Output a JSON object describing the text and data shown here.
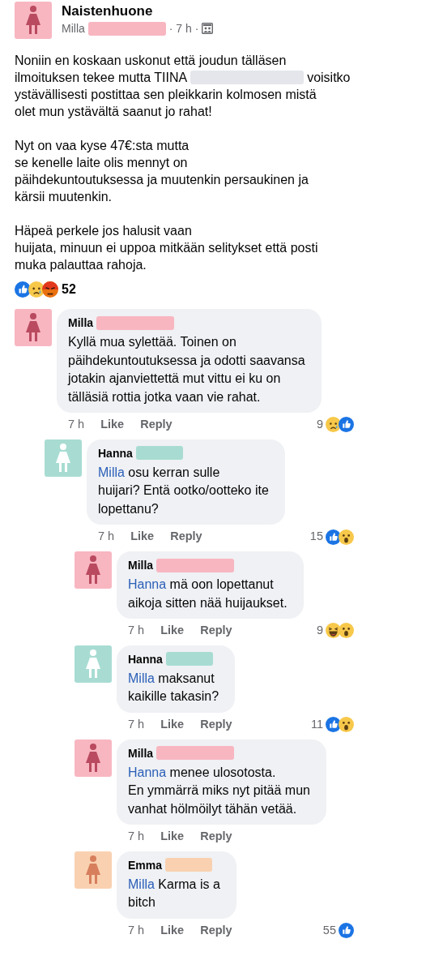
{
  "post": {
    "group": "Naistenhuone",
    "author": "Milla",
    "redaction": {
      "kind": "long"
    },
    "time": "· 7 h ·",
    "avatar": {
      "color": "#f8b6c1",
      "figure": {
        "color": "#b94a5f"
      }
    },
    "paragraphs": [
      [
        {
          "kind": "text",
          "text": "Noniin en koskaan uskonut että joudun tälläsen\nilmoituksen tekee mutta TIINA "
        },
        {
          "kind": "redaction",
          "color": "#e4e6eb"
        },
        {
          "kind": "text",
          "text": " voisitko\nystävällisesti postittaa sen pleikkarin kolmosen mistä\nolet mun ystävältä saanut jo rahat!"
        }
      ],
      [
        {
          "kind": "text",
          "text": "Nyt on vaa kyse 47€:sta mutta\nse kenelle laite olis mennyt on\npäihdekuntoutuksessa ja muutenkin persaukinen ja\nkärsii muutenkin."
        }
      ],
      [
        {
          "kind": "text",
          "text": "Häpeä perkele jos halusit vaan\nhuijata, minuun ei uppoa mitkään selitykset että posti\nmuka palauttaa rahoja."
        }
      ]
    ],
    "reactions": [
      {
        "kind": "like"
      },
      {
        "kind": "sad"
      },
      {
        "kind": "angry"
      }
    ],
    "reaction_count": "52"
  },
  "comments": [
    {
      "author": "Milla",
      "redaction": {
        "kind": "long"
      },
      "avatar": {
        "color": "#f8b6c1",
        "figure": {
          "color": "#b94a5f"
        }
      },
      "text": "Kyllä mua sylettää. Toinen on\npäihdekuntoutuksessa ja odotti saavansa\njotakin ajanviettettä mut vittu ei ku on\ntälläsiä rottia jotka vaan vie rahat.",
      "time": "7 h",
      "actions": [
        "Like",
        "Reply"
      ],
      "reaction_count": "9",
      "reactions": [
        {
          "kind": "sad"
        },
        {
          "kind": "like"
        }
      ],
      "children": [
        {
          "author": "Hanna",
          "redaction": {
            "kind": "short"
          },
          "avatar": {
            "color": "#a8dcd3",
            "figure": {
              "color": "#ffffff"
            }
          },
          "mention": "Milla",
          "text": " osu kerran sulle\nhuijari? Entä ootko/ootteko ite\nlopettanu?",
          "time": "7 h",
          "actions": [
            "Like",
            "Reply"
          ],
          "reaction_count": "15",
          "reactions": [
            {
              "kind": "like"
            },
            {
              "kind": "wow"
            }
          ],
          "children": [
            {
              "author": "Milla",
              "redaction": {
                "kind": "long"
              },
              "avatar": {
                "color": "#f8b6c1",
                "figure": {
                  "color": "#b94a5f"
                }
              },
              "mention": "Hanna",
              "text": " mä oon lopettanut\naikoja sitten nää huijaukset.",
              "time": "7 h",
              "actions": [
                "Like",
                "Reply"
              ],
              "reaction_count": "9",
              "reactions": [
                {
                  "kind": "haha"
                },
                {
                  "kind": "wow"
                }
              ]
            },
            {
              "author": "Hanna",
              "redaction": {
                "kind": "short"
              },
              "avatar": {
                "color": "#a8dcd3",
                "figure": {
                  "color": "#ffffff"
                }
              },
              "mention": "Milla",
              "text": " maksanut\nkaikille takasin?",
              "time": "7 h",
              "actions": [
                "Like",
                "Reply"
              ],
              "reaction_count": "11",
              "reactions": [
                {
                  "kind": "like"
                },
                {
                  "kind": "wow"
                }
              ]
            },
            {
              "author": "Milla",
              "redaction": {
                "kind": "long"
              },
              "avatar": {
                "color": "#f8b6c1",
                "figure": {
                  "color": "#b94a5f"
                }
              },
              "mention": "Hanna",
              "text": " menee ulosotosta.\nEn ymmärrä miks nyt pitää mun\nvanhat hölmöilyt tähän vetää.",
              "time": "7 h",
              "actions": [
                "Like",
                "Reply"
              ]
            },
            {
              "author": "Emma",
              "redaction": {
                "kind": "short"
              },
              "avatar": {
                "color": "#f9d1b1",
                "figure": {
                  "color": "#d77f5d"
                }
              },
              "mention": "Milla",
              "text": " Karma is a\nbitch",
              "time": "7 h",
              "actions": [
                "Like",
                "Reply"
              ],
              "reaction_count": "55",
              "reactions": [
                {
                  "kind": "like"
                }
              ]
            }
          ]
        }
      ]
    }
  ]
}
